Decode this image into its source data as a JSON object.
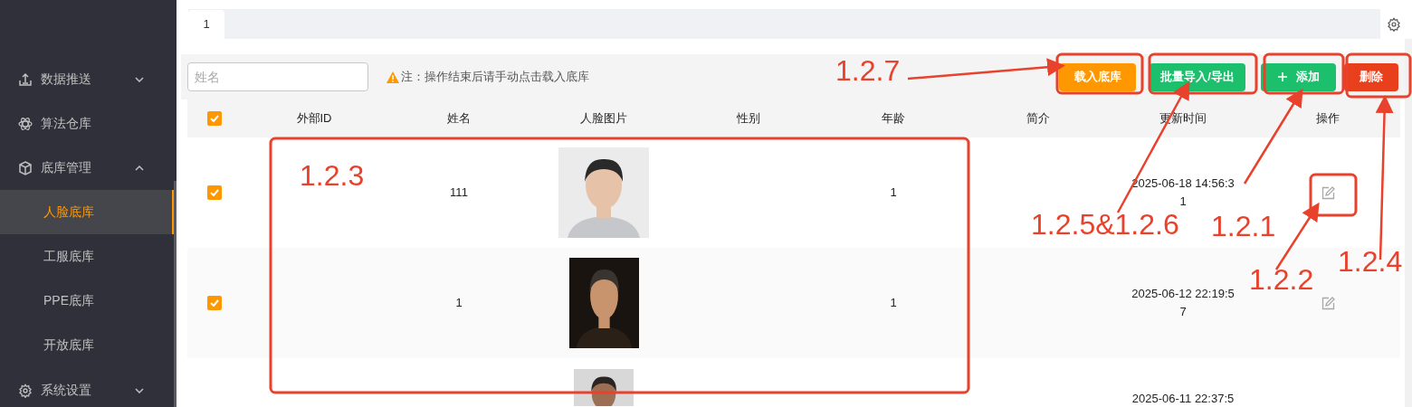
{
  "sidebar": {
    "items": [
      {
        "label": "数据推送",
        "expanded": false
      },
      {
        "label": "算法仓库"
      },
      {
        "label": "底库管理",
        "expanded": true,
        "children": [
          {
            "label": "人脸底库",
            "selected": true
          },
          {
            "label": "工服底库",
            "selected": false
          },
          {
            "label": "PPE底库",
            "selected": false
          },
          {
            "label": "开放底库",
            "selected": false
          }
        ]
      },
      {
        "label": "系统设置",
        "expanded": false
      }
    ]
  },
  "tabs": [
    {
      "label": "1",
      "selected": true
    }
  ],
  "toolbar": {
    "search": {
      "placeholder": "姓名"
    },
    "notice": "注：操作结束后请手动点击载入底库",
    "buttons": [
      {
        "label": "载入底库",
        "kind": "load"
      },
      {
        "label": "批量导入/导出",
        "kind": "batch"
      },
      {
        "label": "添加",
        "kind": "add"
      },
      {
        "label": "删除",
        "kind": "delete"
      }
    ]
  },
  "table": {
    "all_checked": true,
    "columns": [
      "外部ID",
      "姓名",
      "人脸图片",
      "性别",
      "年龄",
      "简介",
      "更新时间",
      "操作"
    ],
    "rows": [
      {
        "checked": true,
        "name": "111",
        "age": "1",
        "updated": "2025-06-18 14:56:31"
      },
      {
        "checked": true,
        "name": "1",
        "age": "1",
        "updated": "2025-06-12 22:19:57"
      },
      {
        "updated": "2025-06-11 22:37:5"
      }
    ]
  },
  "annotations": [
    {
      "label": "1.2.7"
    },
    {
      "label": "1.2.3"
    },
    {
      "label": "1.2.5&1.2.6"
    },
    {
      "label": "1.2.1"
    },
    {
      "label": "1.2.2"
    },
    {
      "label": "1.2.4"
    }
  ]
}
